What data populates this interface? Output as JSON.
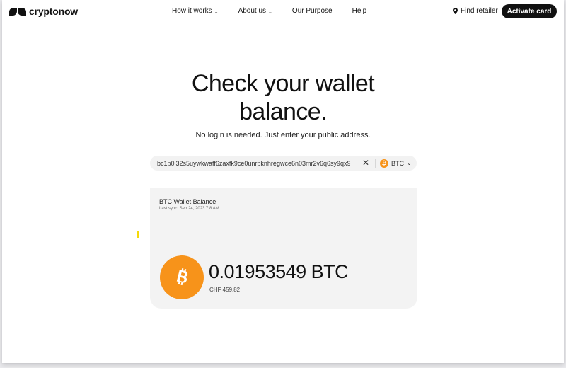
{
  "brand": {
    "name": "cryptonow"
  },
  "nav": {
    "items": [
      {
        "label": "How it works",
        "dropdown": true
      },
      {
        "label": "About us",
        "dropdown": true
      },
      {
        "label": "Our Purpose",
        "dropdown": false
      },
      {
        "label": "Help",
        "dropdown": false
      }
    ],
    "find_retailer": "Find retailer",
    "activate_card": "Activate card"
  },
  "hero": {
    "title_line1": "Check your wallet",
    "title_line2": "balance.",
    "subtitle": "No login is needed. Just enter your public address."
  },
  "search": {
    "value": "bc1p0l32s5uywkwaff6zaxfk9ce0unrpknhregwce6n03mr2v6q6sy9qx9",
    "clear_icon": "close-icon",
    "currency": "BTC"
  },
  "wallet": {
    "title": "BTC Wallet Balance",
    "last_sync": "Last sync: Sep 24, 2023 7:8 AM",
    "balance": "0.01953549 BTC",
    "fiat": "CHF 459.82"
  },
  "colors": {
    "bitcoin": "#f7931a",
    "accent_dark": "#111111",
    "card_bg": "#f3f3f3"
  }
}
